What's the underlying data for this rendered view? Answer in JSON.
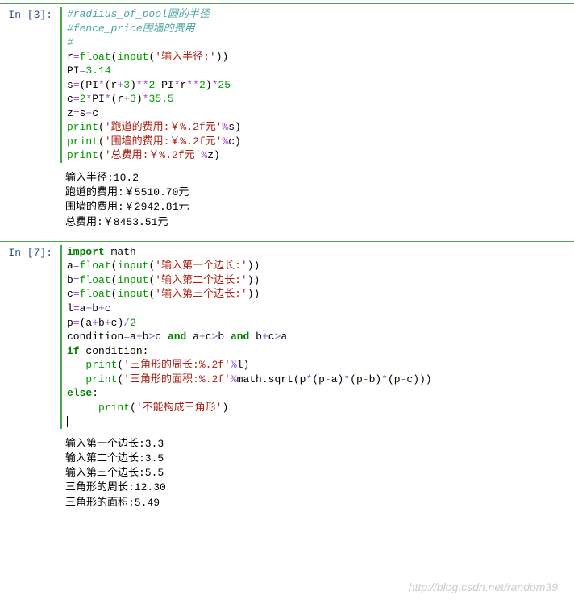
{
  "cells": [
    {
      "prompt": "In  [3]:",
      "output": "输入半径:10.2\n跑道的费用:￥5510.70元\n围墙的费用:￥2942.81元\n总费用:￥8453.51元"
    },
    {
      "prompt": "In  [7]:",
      "output": "输入第一个边长:3.3\n输入第二个边长:3.5\n输入第三个边长:5.5\n三角形的周长:12.30\n三角形的面积:5.49"
    }
  ],
  "code1": {
    "l1": "#radiius_of_pool圆的半径",
    "l2": "#fence_price围墙的费用",
    "l3": "#",
    "float": "float",
    "input": "input",
    "print": "print",
    "s1": "'输入半径:'",
    "pi": "3.14",
    "n3": "3",
    "n2": "2",
    "n25": "25",
    "n35_5": "35.5",
    "sp_run": "'跑道的费用:￥%.2f元'",
    "sp_wall": "'围墙的费用:￥%.2f元'",
    "sp_total": "'总费用:￥%.2f元'"
  },
  "code2": {
    "import": "import",
    "math": "math",
    "float": "float",
    "input": "input",
    "print": "print",
    "s_a": "'输入第一个边长:'",
    "s_b": "'输入第二个边长:'",
    "s_c": "'输入第三个边长:'",
    "n2": "2",
    "and": "and",
    "if": "if",
    "else": "else",
    "s_peri": "'三角形的周长:%.2f'",
    "s_area": "'三角形的面积:%.2f'",
    "s_no": "'不能构成三角形'"
  },
  "watermark": "http://blog.csdn.net/random39"
}
